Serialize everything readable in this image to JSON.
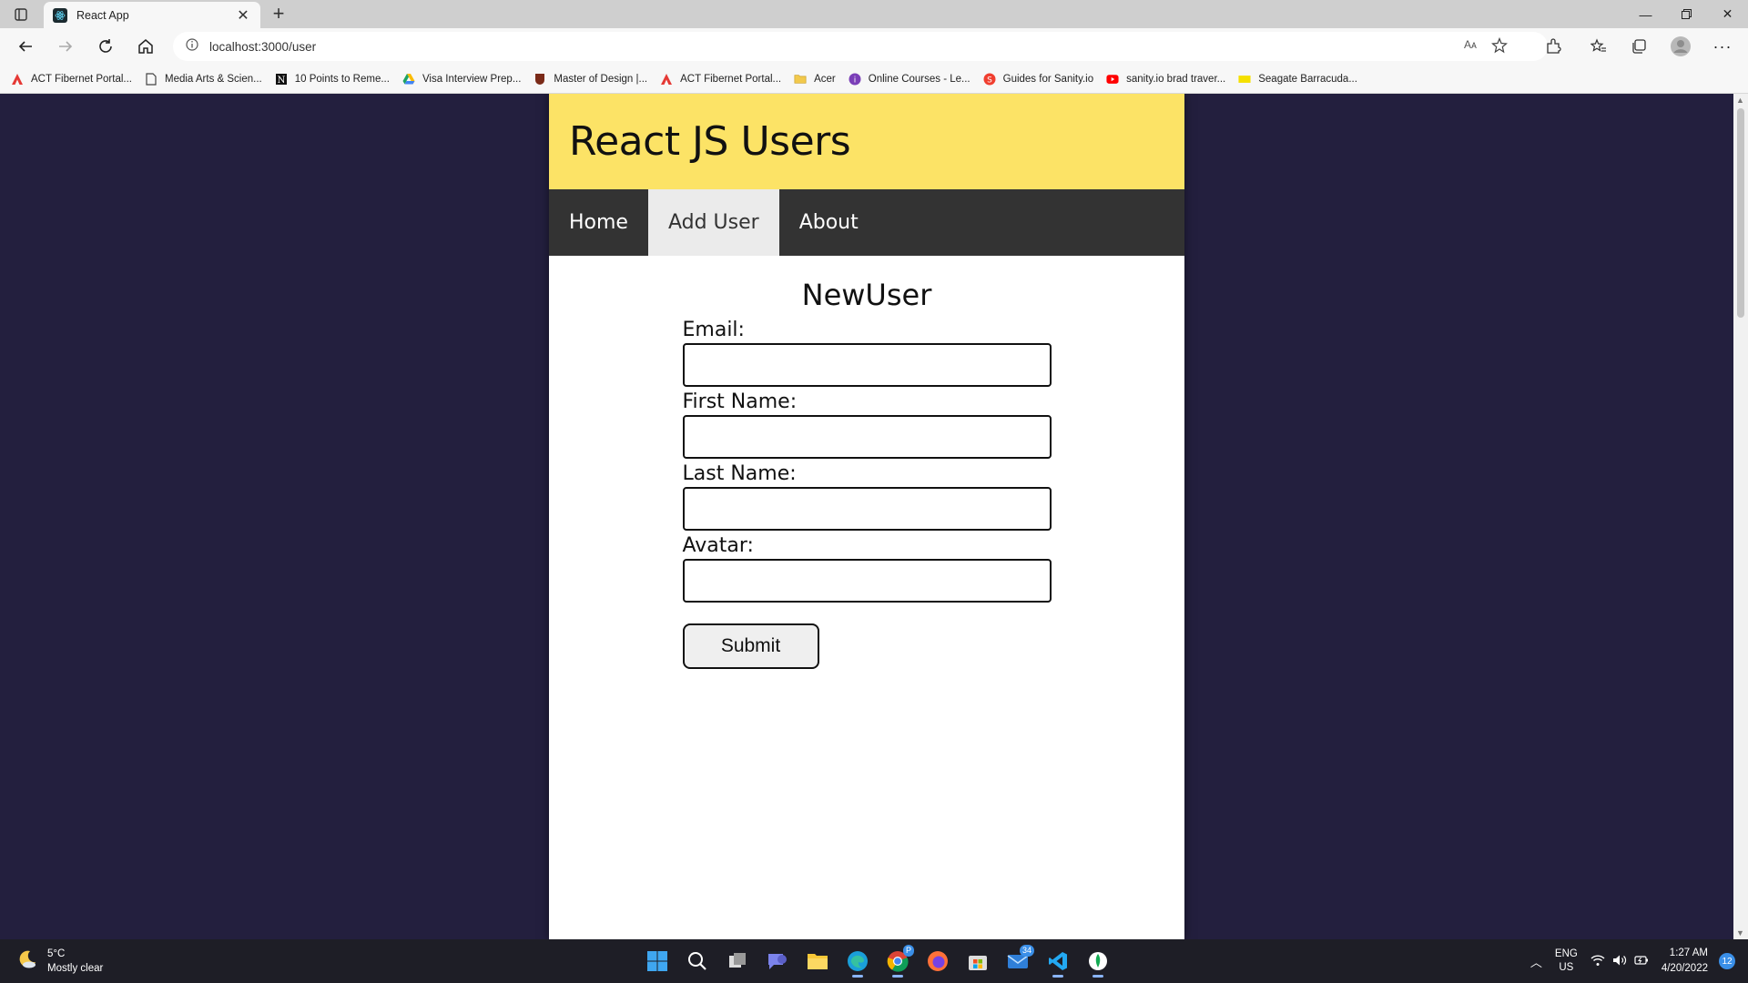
{
  "browser": {
    "tab_title": "React App",
    "url": "localhost:3000/user",
    "reader_label": "Aᴀ"
  },
  "bookmarks": [
    {
      "label": "ACT Fibernet Portal...",
      "icon": "act-logo-icon",
      "color": "#e53935"
    },
    {
      "label": "Media Arts & Scien...",
      "icon": "page-icon",
      "color": "#444444"
    },
    {
      "label": "10 Points to Reme...",
      "icon": "notion-icon",
      "color": "#111111"
    },
    {
      "label": "Visa Interview Prep...",
      "icon": "drive-icon",
      "color": "#1ea362"
    },
    {
      "label": "Master of Design |...",
      "icon": "crest-icon",
      "color": "#7a2a18"
    },
    {
      "label": "ACT Fibernet Portal...",
      "icon": "act-logo-icon",
      "color": "#e53935"
    },
    {
      "label": "Acer",
      "icon": "folder-icon",
      "color": "#f2c94c"
    },
    {
      "label": "Online Courses - Le...",
      "icon": "courses-icon",
      "color": "#7b3fb8"
    },
    {
      "label": "Guides for Sanity.io",
      "icon": "sanity-icon",
      "color": "#f03e2f"
    },
    {
      "label": "sanity.io brad traver...",
      "icon": "youtube-icon",
      "color": "#ff0000"
    },
    {
      "label": "Seagate Barracuda...",
      "icon": "seagate-icon",
      "color": "#f5e000"
    }
  ],
  "app": {
    "title": "React JS Users",
    "nav": [
      {
        "label": "Home",
        "active": false
      },
      {
        "label": "Add User",
        "active": true
      },
      {
        "label": "About",
        "active": false
      }
    ],
    "colors": {
      "header": "#fce366",
      "nav": "#333333",
      "page_bg": "#231f3e"
    }
  },
  "form": {
    "title": "NewUser",
    "fields": [
      {
        "label": "Email:",
        "value": ""
      },
      {
        "label": "First Name:",
        "value": ""
      },
      {
        "label": "Last Name:",
        "value": ""
      },
      {
        "label": "Avatar:",
        "value": ""
      }
    ],
    "submit_label": "Submit"
  },
  "taskbar": {
    "weather_temp": "5°C",
    "weather_desc": "Mostly clear",
    "mail_badge": "34",
    "chrome_badge": "P",
    "lang_1": "ENG",
    "lang_2": "US",
    "time": "1:27 AM",
    "date": "4/20/2022",
    "notifications": "12"
  }
}
